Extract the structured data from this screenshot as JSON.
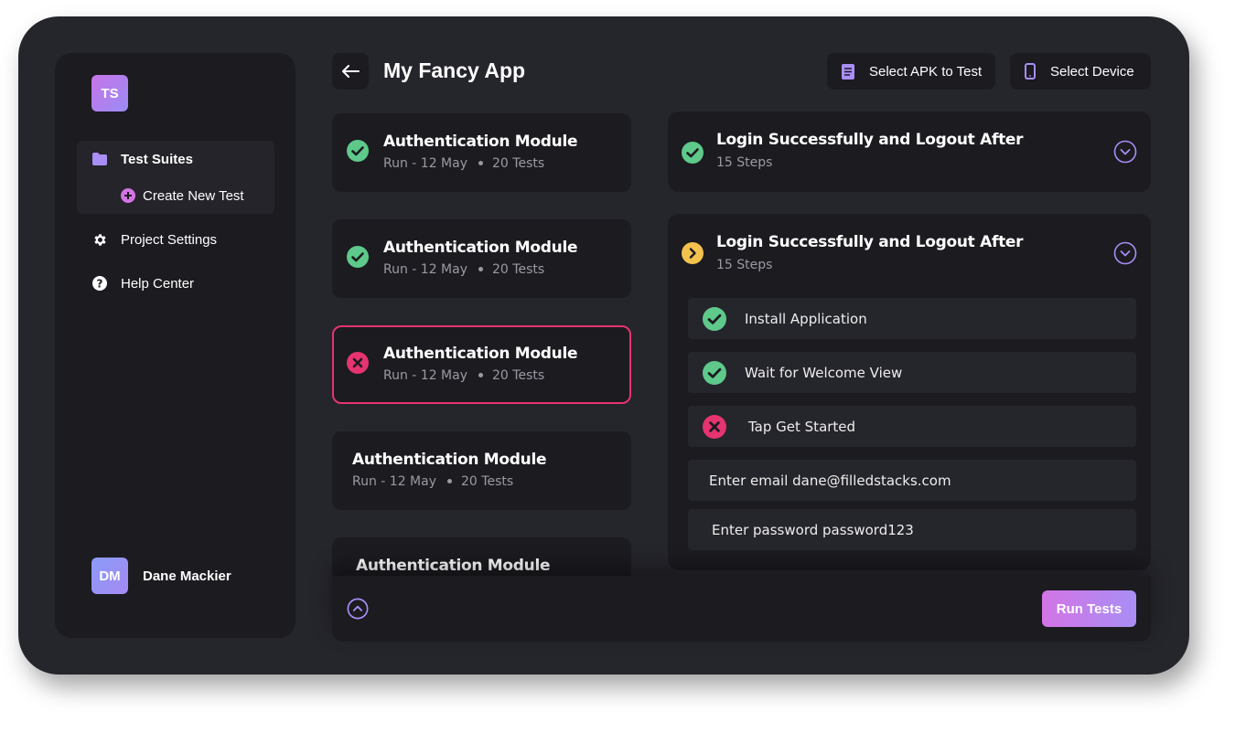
{
  "app": {
    "logo_initials": "TS",
    "title": "My Fancy App"
  },
  "sidebar": {
    "items": [
      {
        "label": "Test Suites",
        "icon": "folder-icon",
        "active": true
      },
      {
        "label": "Create New Test",
        "icon": "plus-circle-icon"
      },
      {
        "label": "Project Settings",
        "icon": "gear-icon"
      },
      {
        "label": "Help Center",
        "icon": "help-icon"
      }
    ],
    "user": {
      "initials": "DM",
      "name": "Dane Mackier"
    }
  },
  "header": {
    "select_apk_label": "Select APK to Test",
    "select_device_label": "Select Device"
  },
  "suites": [
    {
      "title": "Authentication Module",
      "run": "Run - 12 May",
      "tests": "20 Tests",
      "status": "passed"
    },
    {
      "title": "Authentication Module",
      "run": "Run - 12 May",
      "tests": "20 Tests",
      "status": "passed"
    },
    {
      "title": "Authentication Module",
      "run": "Run - 12 May",
      "tests": "20 Tests",
      "status": "failed"
    },
    {
      "title": "Authentication Module",
      "run": "Run - 12 May",
      "tests": "20 Tests",
      "status": "none"
    },
    {
      "title": "Authentication Module",
      "run": "",
      "tests": "",
      "status": "none"
    }
  ],
  "tests": [
    {
      "title": "Login Successfully and Logout After",
      "steps_count": "15 Steps",
      "status": "passed"
    },
    {
      "title": "Login Successfully and Logout After",
      "steps_count": "15 Steps",
      "status": "running",
      "steps": [
        {
          "label": "Install Application",
          "status": "passed"
        },
        {
          "label": "Wait for Welcome View",
          "status": "passed"
        },
        {
          "label": "Tap Get Started",
          "status": "failed"
        },
        {
          "label": "Enter email dane@filledstacks.com",
          "status": "pending"
        },
        {
          "label": "Enter password password123",
          "status": "pending"
        }
      ]
    }
  ],
  "footer": {
    "run_label": "Run Tests"
  },
  "colors": {
    "passed": "#5ec98a",
    "failed": "#e5346f",
    "running": "#f2c14e",
    "accent": "#a98ef5"
  }
}
